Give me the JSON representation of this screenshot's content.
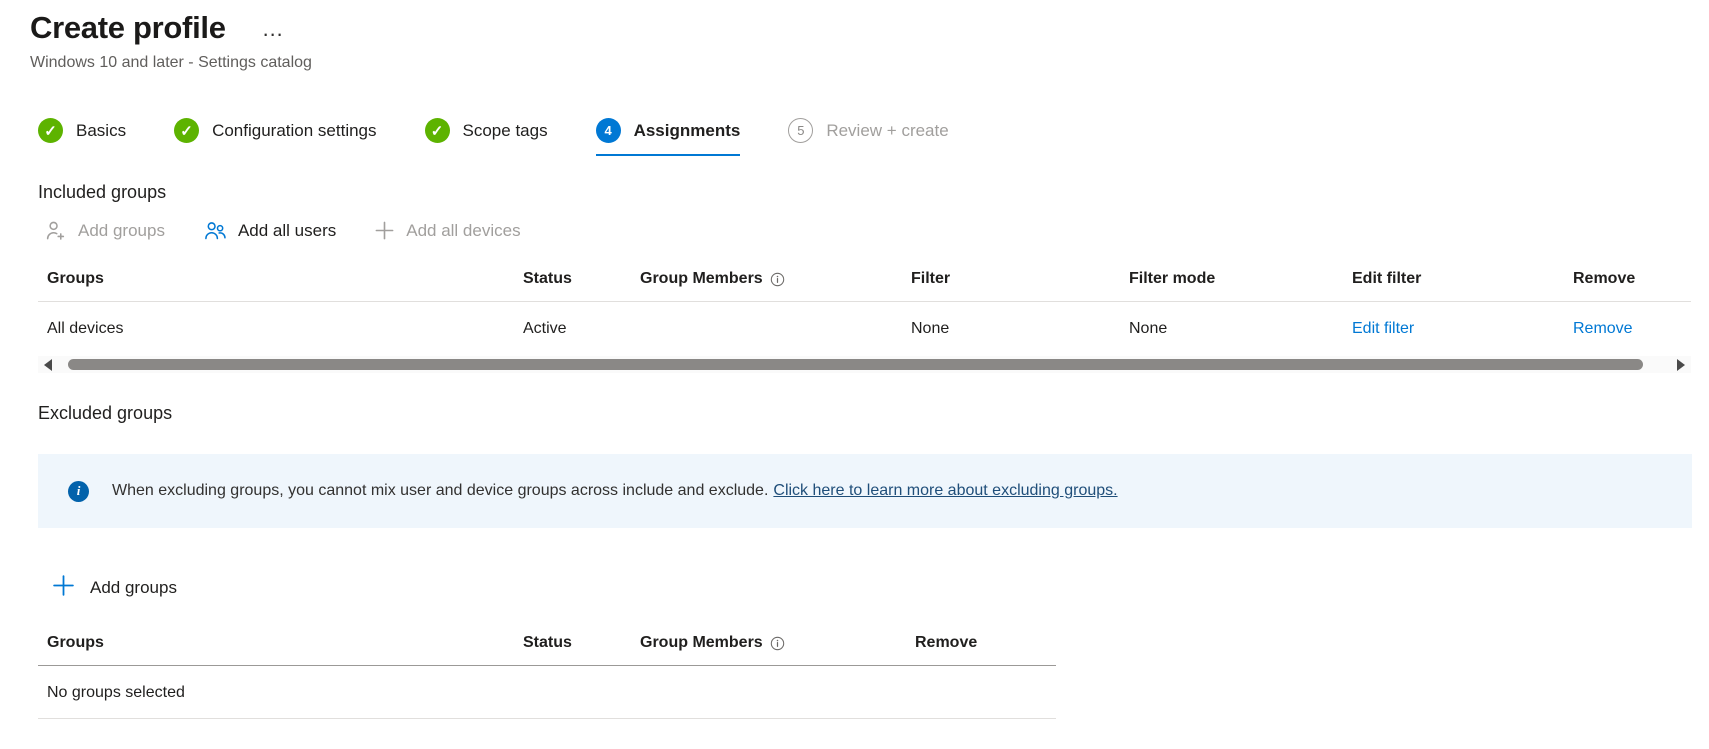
{
  "colors": {
    "accent_blue": "#0078d4",
    "success_green": "#5db300",
    "disabled_gray": "#a19f9d",
    "text_dark": "#201f1e",
    "text_gray": "#605e5c",
    "banner_bg": "#eff6fc",
    "banner_link": "#1f4e79",
    "scroll_thumb": "#8a8886"
  },
  "icons": {
    "check": "✓",
    "more": "…",
    "info_i": "i"
  },
  "header": {
    "title": "Create profile",
    "subtitle": "Windows 10 and later - Settings catalog"
  },
  "steps": [
    {
      "label": "Basics",
      "state": "complete"
    },
    {
      "label": "Configuration settings",
      "state": "complete"
    },
    {
      "label": "Scope tags",
      "state": "complete"
    },
    {
      "label": "Assignments",
      "state": "active",
      "number": "4"
    },
    {
      "label": "Review + create",
      "state": "upcoming",
      "number": "5"
    }
  ],
  "included_groups": {
    "section_title": "Included groups",
    "toolbar": {
      "add_groups_label": "Add groups",
      "add_all_users_label": "Add all users",
      "add_all_devices_label": "Add all devices"
    },
    "table": {
      "headers": {
        "groups": "Groups",
        "status": "Status",
        "group_members": "Group Members",
        "filter": "Filter",
        "filter_mode": "Filter mode",
        "edit_filter": "Edit filter",
        "remove": "Remove"
      },
      "rows": [
        {
          "groups": "All devices",
          "status": "Active",
          "group_members": "",
          "filter": "None",
          "filter_mode": "None",
          "edit_filter_link": "Edit filter",
          "remove_link": "Remove"
        }
      ]
    }
  },
  "excluded_groups": {
    "section_title": "Excluded groups",
    "info_banner": {
      "message": "When excluding groups, you cannot mix user and device groups across include and exclude.",
      "link_text": "Click here to learn more about excluding groups."
    },
    "add_groups_label": "Add groups",
    "table": {
      "headers": {
        "groups": "Groups",
        "status": "Status",
        "group_members": "Group Members",
        "remove": "Remove"
      },
      "empty_message": "No groups selected"
    }
  }
}
